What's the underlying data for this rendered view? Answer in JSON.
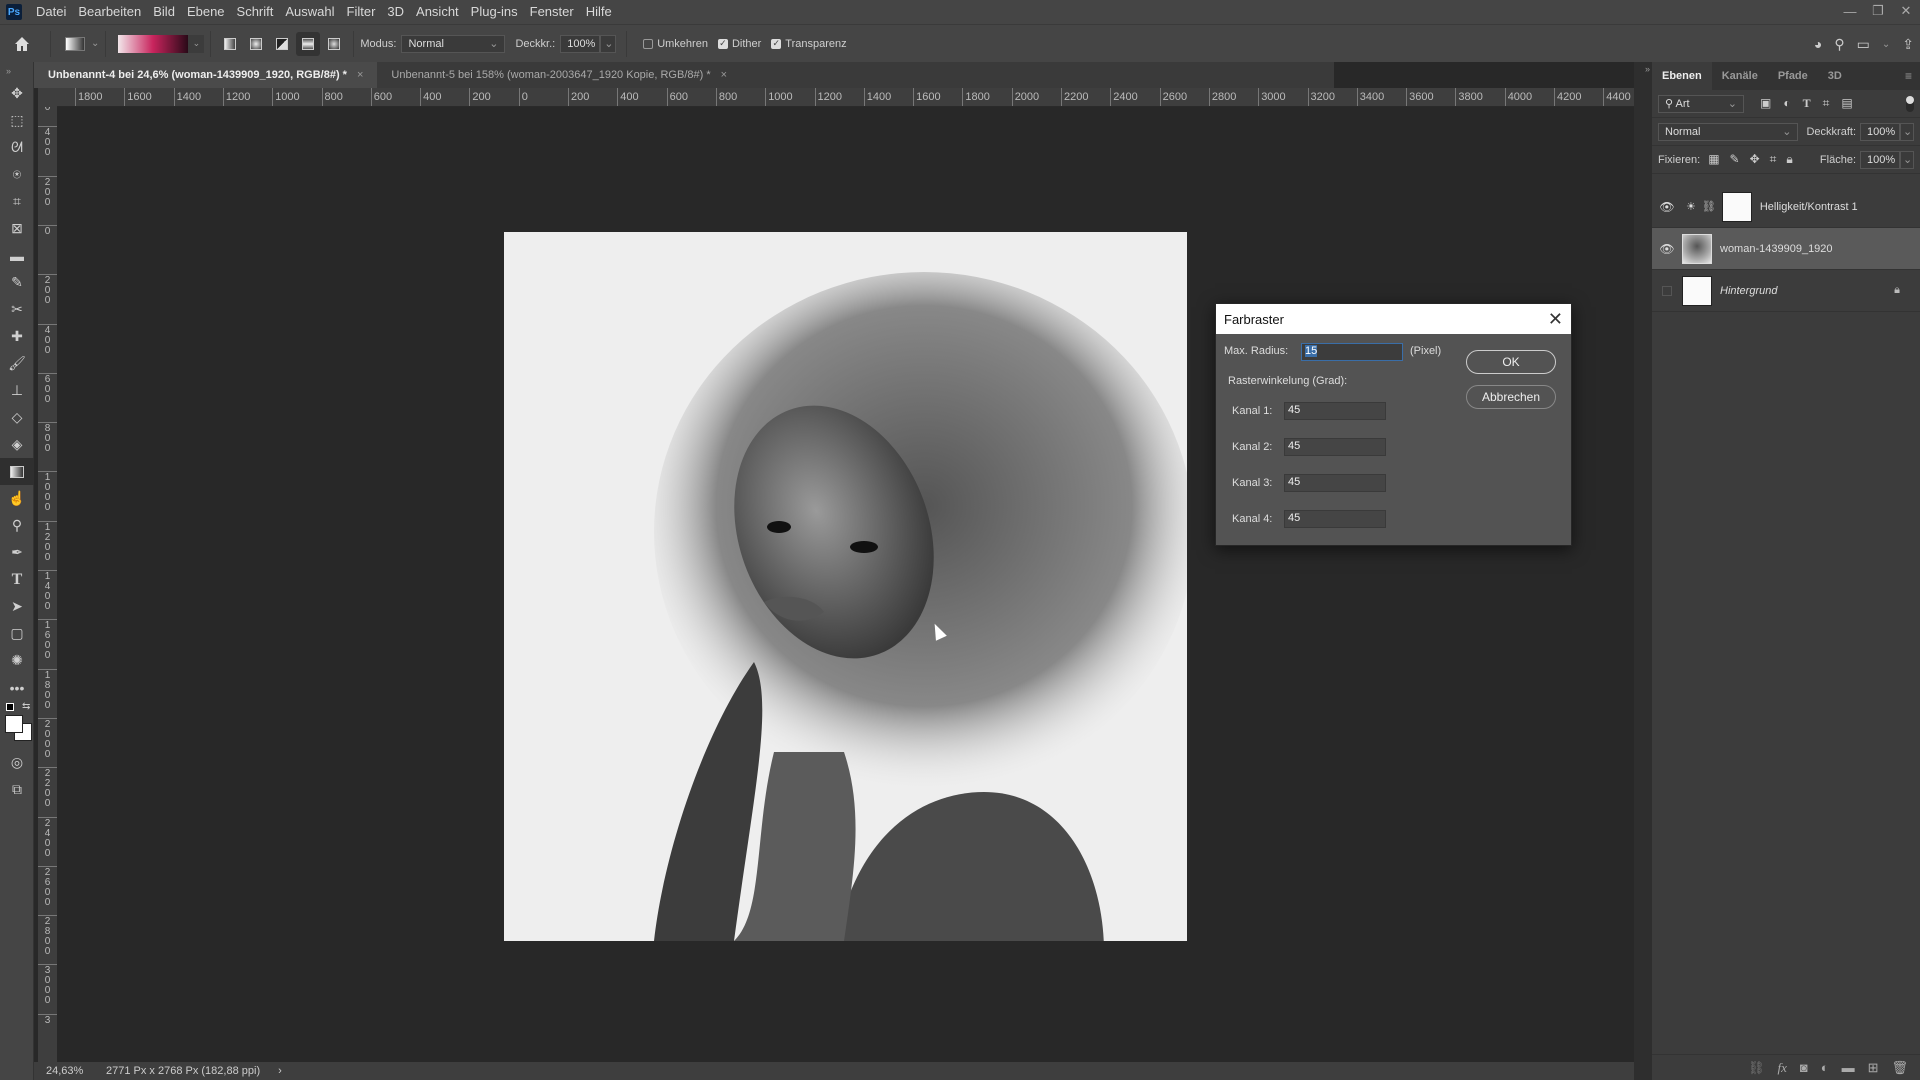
{
  "app": {
    "logo": "Ps"
  },
  "menu": [
    "Datei",
    "Bearbeiten",
    "Bild",
    "Ebene",
    "Schrift",
    "Auswahl",
    "Filter",
    "3D",
    "Ansicht",
    "Plug-ins",
    "Fenster",
    "Hilfe"
  ],
  "window_controls": {
    "minimize": "—",
    "restore": "❐",
    "close": "✕"
  },
  "options": {
    "modus_label": "Modus:",
    "modus_value": "Normal",
    "deckkr_label": "Deckkr.:",
    "deckkr_value": "100%",
    "umkehren_label": "Umkehren",
    "umkehren_checked": false,
    "dither_label": "Dither",
    "dither_checked": true,
    "transparenz_label": "Transparenz",
    "transparenz_checked": true,
    "gradient_colors": [
      "#f2e6ea",
      "#c8245d",
      "#2a0a18"
    ]
  },
  "tabs": [
    {
      "label": "Unbenannt-4 bei 24,6% (woman-1439909_1920, RGB/8#) *",
      "active": true
    },
    {
      "label": "Unbenannt-5 bei 158% (woman-2003647_1920 Kopie, RGB/8#) *",
      "active": false
    }
  ],
  "ruler_h": [
    "1800",
    "1600",
    "1400",
    "1200",
    "1000",
    "800",
    "600",
    "400",
    "200",
    "0",
    "200",
    "400",
    "600",
    "800",
    "1000",
    "1200",
    "1400",
    "1600",
    "1800",
    "2000",
    "2200",
    "2400",
    "2600",
    "2800",
    "3000",
    "3200",
    "3400",
    "3600",
    "3800",
    "4000",
    "4200",
    "4400"
  ],
  "ruler_v": [
    "0",
    "400",
    "200",
    "0",
    "200",
    "400",
    "600",
    "800",
    "1000",
    "1200",
    "1400",
    "1600",
    "1800",
    "2000",
    "2200",
    "2400",
    "2600",
    "2800",
    "3000",
    "3"
  ],
  "status": {
    "zoom": "24,63%",
    "doc_info": "2771 Px x 2768 Px (182,88 ppi)",
    "arrow": "›"
  },
  "layers_panel": {
    "tabs": [
      "Ebenen",
      "Kanäle",
      "Pfade",
      "3D"
    ],
    "filter_label": "Art",
    "blend_mode": "Normal",
    "opacity_label": "Deckkraft:",
    "opacity_value": "100%",
    "lock_label": "Fixieren:",
    "fill_label": "Fläche:",
    "fill_value": "100%",
    "layers": [
      {
        "name": "Helligkeit/Kontrast 1",
        "visible": true,
        "type": "adjustment"
      },
      {
        "name": "woman-1439909_1920",
        "visible": true,
        "type": "image",
        "selected": true
      },
      {
        "name": "Hintergrund",
        "visible": false,
        "type": "background",
        "locked": true
      }
    ]
  },
  "dialog": {
    "title": "Farbraster",
    "max_radius_label": "Max. Radius:",
    "max_radius_value": "15",
    "unit": "(Pixel)",
    "angle_label": "Rasterwinkelung (Grad):",
    "channels": [
      {
        "label": "Kanal 1:",
        "value": "45"
      },
      {
        "label": "Kanal 2:",
        "value": "45"
      },
      {
        "label": "Kanal 3:",
        "value": "45"
      },
      {
        "label": "Kanal 4:",
        "value": "45"
      }
    ],
    "ok": "OK",
    "cancel": "Abbrechen"
  }
}
